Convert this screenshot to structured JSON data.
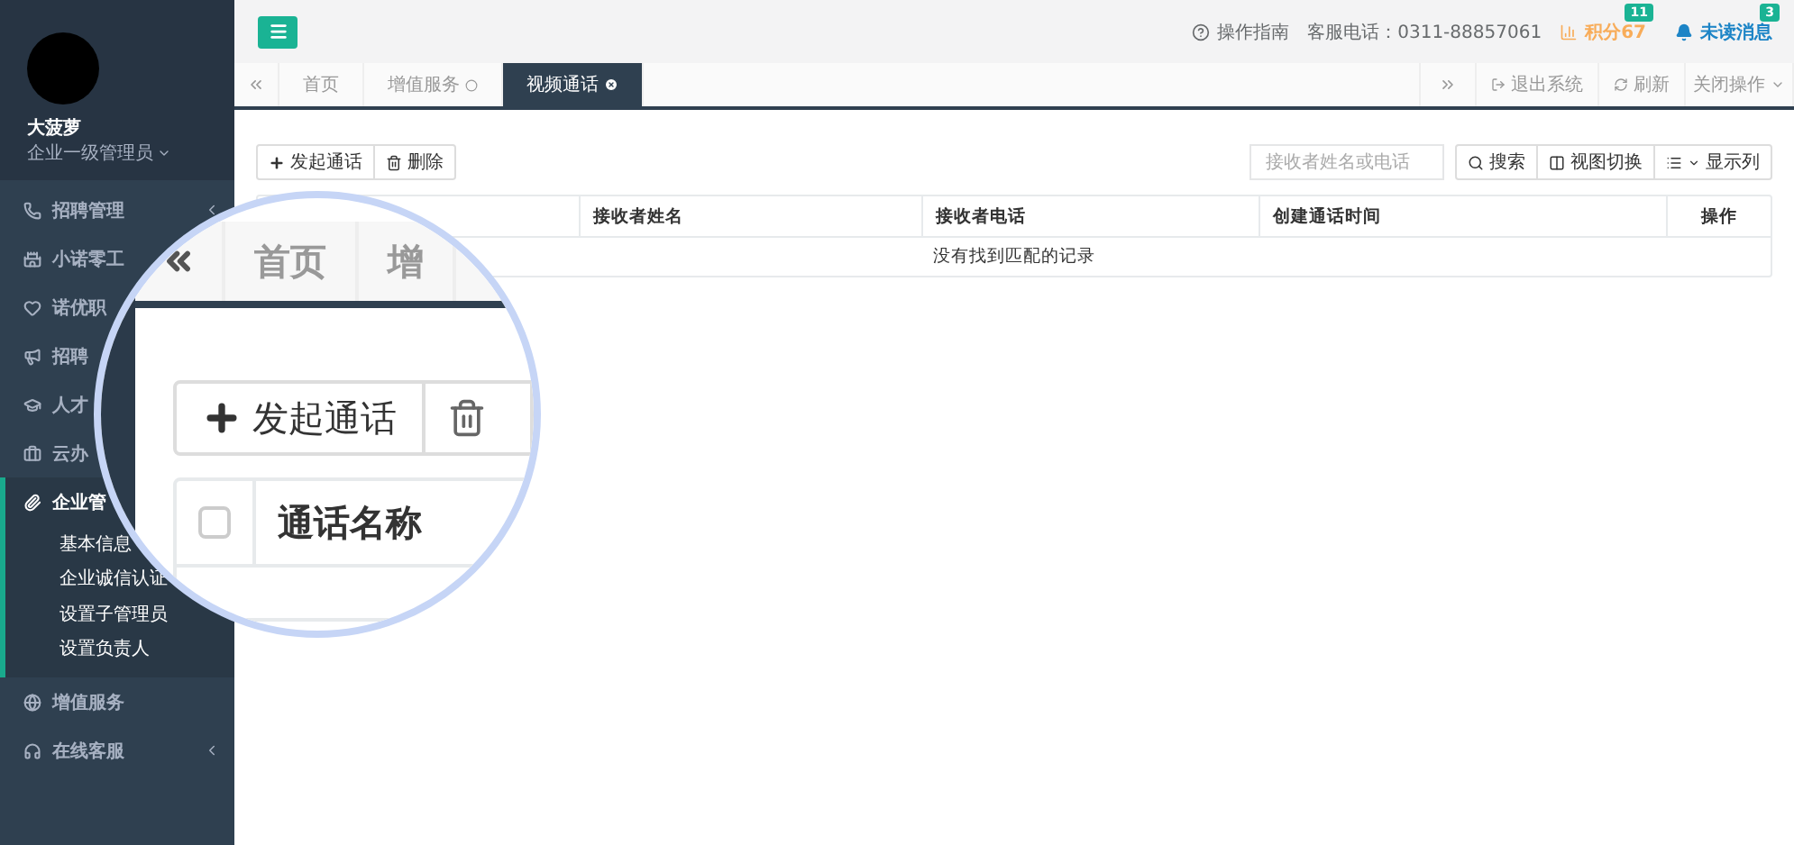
{
  "profile": {
    "name": "大菠萝",
    "role": "企业一级管理员"
  },
  "sidebar": {
    "items": [
      {
        "label": "招聘管理",
        "has_arrow": true,
        "active": false
      },
      {
        "label": "小诺零工",
        "active": false
      },
      {
        "label": "诺优职",
        "active": false
      },
      {
        "label": "招聘",
        "active": false
      },
      {
        "label": "人才",
        "active": false
      },
      {
        "label": "云办",
        "active": false
      },
      {
        "label": "企业管",
        "active": true,
        "children": [
          {
            "label": "基本信息"
          },
          {
            "label": "企业诚信认证"
          },
          {
            "label": "设置子管理员"
          },
          {
            "label": "设置负责人"
          }
        ]
      },
      {
        "label": "增值服务",
        "has_arrow": false,
        "active": false
      },
      {
        "label": "在线客服",
        "has_arrow": true,
        "active": false
      }
    ]
  },
  "header": {
    "guide": "操作指南",
    "hotline": "客服电话：0311-88857061",
    "points": {
      "label": "积分67",
      "badge": "11"
    },
    "messages": {
      "label": "未读消息",
      "badge": "3"
    }
  },
  "tabs": [
    {
      "label": "首页",
      "closable": false,
      "selected": false
    },
    {
      "label": "增值服务",
      "closable": true,
      "selected": false
    },
    {
      "label": "视频通话",
      "closable": true,
      "selected": true
    }
  ],
  "tab_actions": [
    "退出系统",
    "刷新",
    "关闭操作"
  ],
  "toolbar": {
    "buttons": [
      "发起通话",
      "删除"
    ],
    "search_placeholder": "接收者姓名或电话",
    "right_buttons": [
      "搜索",
      "视图切换",
      "显示列"
    ]
  },
  "table": {
    "columns": [
      "接收者姓名",
      "接收者电话",
      "创建通话时间",
      "操作"
    ],
    "empty_text": "没有找到匹配的记录"
  },
  "magnifier": {
    "tabs": [
      "首页",
      "增"
    ],
    "button": "发起通话",
    "checked": false,
    "column": "通话名称"
  }
}
